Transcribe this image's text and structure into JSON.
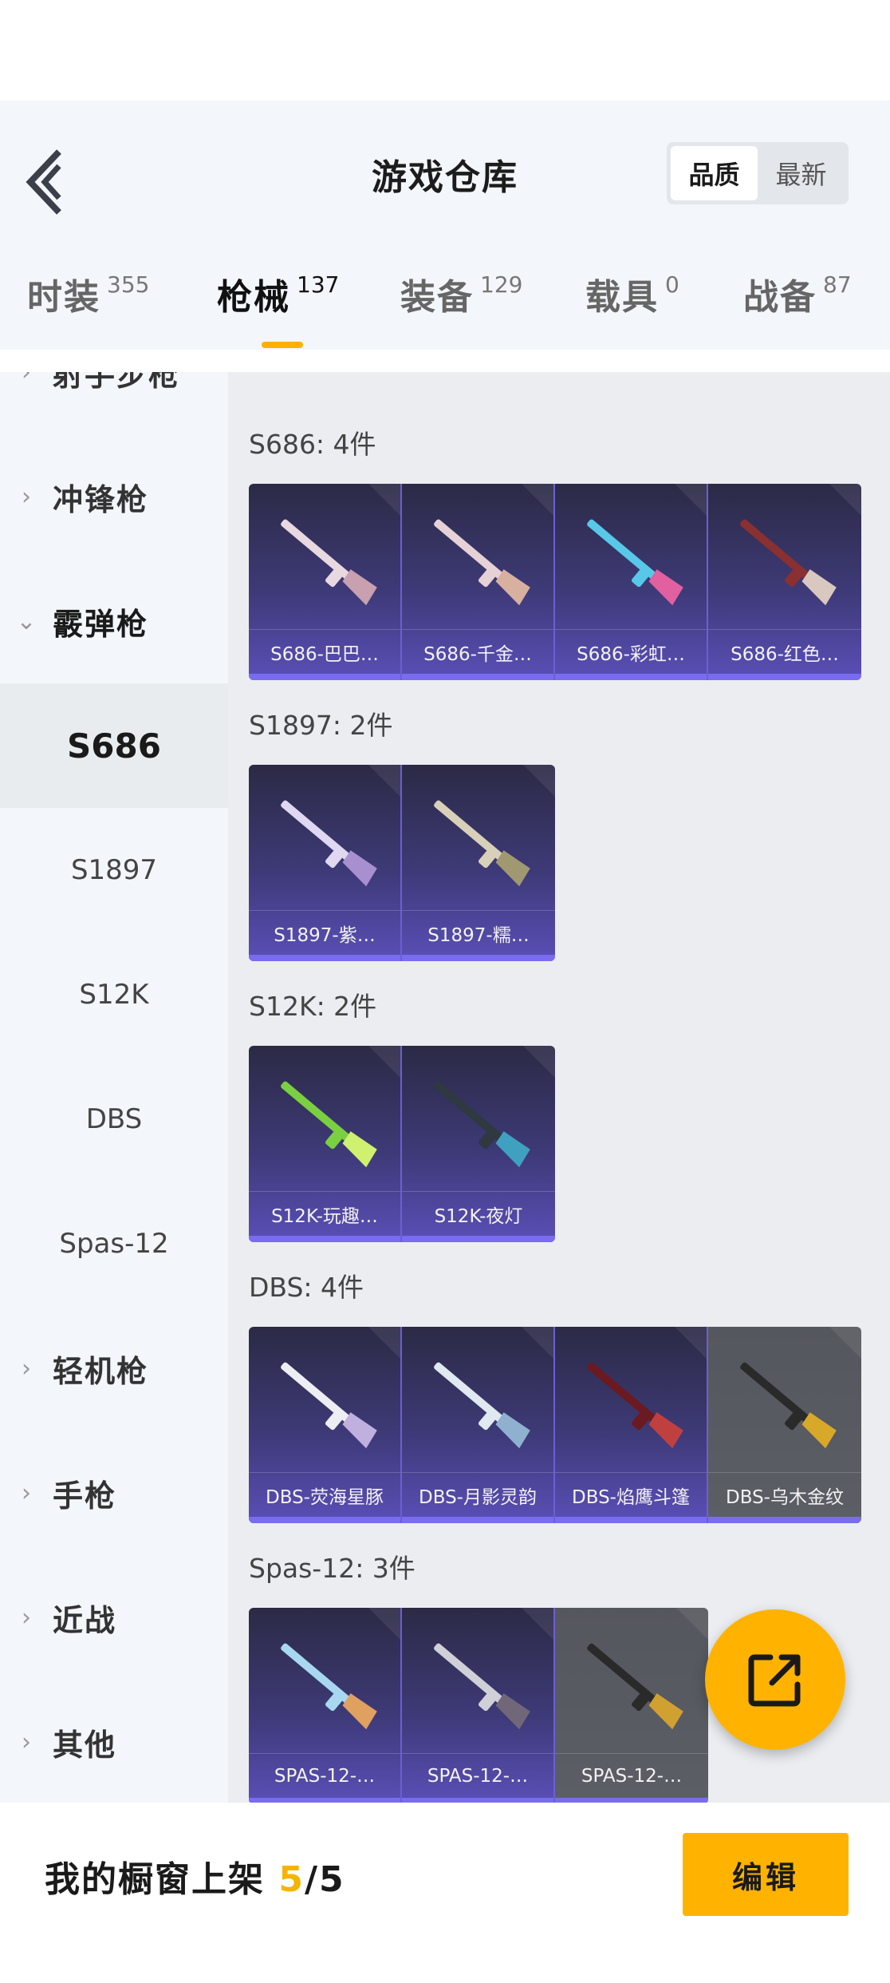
{
  "header": {
    "title": "游戏仓库",
    "sort_options": [
      "品质",
      "最新"
    ],
    "active_sort": "品质"
  },
  "tabs": [
    {
      "label": "时装",
      "count": "355"
    },
    {
      "label": "枪械",
      "count": "137"
    },
    {
      "label": "装备",
      "count": "129"
    },
    {
      "label": "载具",
      "count": "0"
    },
    {
      "label": "战备",
      "count": "87"
    }
  ],
  "active_tab": "枪械",
  "sidebar": {
    "items": [
      {
        "label": "射手步枪",
        "type": "category",
        "expanded": false
      },
      {
        "label": "冲锋枪",
        "type": "category",
        "expanded": false
      },
      {
        "label": "霰弹枪",
        "type": "category",
        "expanded": true
      },
      {
        "label": "S686",
        "type": "sub",
        "selected": true
      },
      {
        "label": "S1897",
        "type": "sub"
      },
      {
        "label": "S12K",
        "type": "sub"
      },
      {
        "label": "DBS",
        "type": "sub"
      },
      {
        "label": "Spas-12",
        "type": "sub"
      },
      {
        "label": "轻机枪",
        "type": "category",
        "expanded": false
      },
      {
        "label": "手枪",
        "type": "category",
        "expanded": false
      },
      {
        "label": "近战",
        "type": "category",
        "expanded": false
      },
      {
        "label": "其他",
        "type": "category",
        "expanded": false
      }
    ]
  },
  "groups": [
    {
      "title": "S686: 4件",
      "items": [
        {
          "label": "S686-巴巴…",
          "tone": "purple",
          "gun": "#e8d8e0",
          "accent": "#c8a0b0"
        },
        {
          "label": "S686-千金…",
          "tone": "purple",
          "gun": "#e6d2d6",
          "accent": "#d8b0a0"
        },
        {
          "label": "S686-彩虹…",
          "tone": "purple",
          "gun": "#58c8e8",
          "accent": "#e060a0"
        },
        {
          "label": "S686-红色…",
          "tone": "purple",
          "gun": "#8a3030",
          "accent": "#d8c8c0"
        }
      ]
    },
    {
      "title": "S1897: 2件",
      "items": [
        {
          "label": "S1897-紫…",
          "tone": "purple",
          "gun": "#e0d8f0",
          "accent": "#a890d0"
        },
        {
          "label": "S1897-糯…",
          "tone": "purple",
          "gun": "#d8d0b8",
          "accent": "#a09870"
        }
      ]
    },
    {
      "title": "S12K: 2件",
      "items": [
        {
          "label": "S12K-玩趣…",
          "tone": "purple",
          "gun": "#7ad040",
          "accent": "#d0f070"
        },
        {
          "label": "S12K-夜灯",
          "tone": "purple",
          "gun": "#303840",
          "accent": "#40a0c0"
        }
      ]
    },
    {
      "title": "DBS: 4件",
      "items": [
        {
          "label": "DBS-荧海星豚",
          "tone": "purple",
          "gun": "#eceef4",
          "accent": "#c0b0e0"
        },
        {
          "label": "DBS-月影灵韵",
          "tone": "purple",
          "gun": "#e0e8f0",
          "accent": "#90b0d0"
        },
        {
          "label": "DBS-焰鹰斗篷",
          "tone": "purple",
          "gun": "#6a1a20",
          "accent": "#c04040"
        },
        {
          "label": "DBS-乌木金纹",
          "tone": "grey",
          "gun": "#2a2a2a",
          "accent": "#d8a828"
        }
      ]
    },
    {
      "title": "Spas-12: 3件",
      "items": [
        {
          "label": "SPAS-12-…",
          "tone": "purple",
          "gun": "#a8d8f0",
          "accent": "#e0a060"
        },
        {
          "label": "SPAS-12-…",
          "tone": "purple",
          "gun": "#d0d0d8",
          "accent": "#706878"
        },
        {
          "label": "SPAS-12-…",
          "tone": "grey",
          "gun": "#2a2a2a",
          "accent": "#d0a030"
        }
      ]
    }
  ],
  "bottom": {
    "showcase_label": "我的橱窗上架 ",
    "showcase_current": "5",
    "showcase_sep": "/",
    "showcase_total": "5",
    "edit_label": "编辑"
  },
  "colors": {
    "accent": "#ffb300",
    "highlight": "#f5b400",
    "card_border": "#7a6cf0"
  },
  "icons": [
    "back-arrow-icon",
    "chevron-right-icon",
    "chevron-down-icon",
    "share-icon"
  ]
}
